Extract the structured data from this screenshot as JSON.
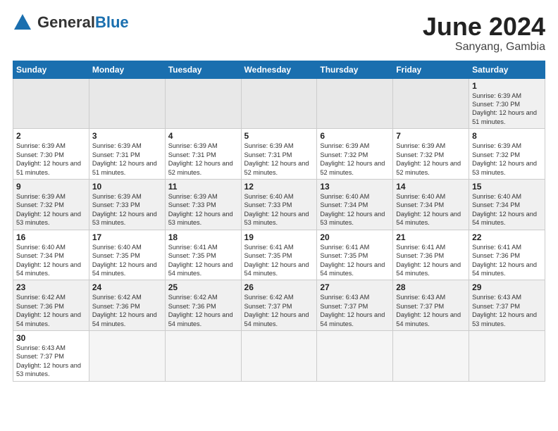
{
  "header": {
    "logo_general": "General",
    "logo_blue": "Blue",
    "title": "June 2024",
    "subtitle": "Sanyang, Gambia"
  },
  "weekdays": [
    "Sunday",
    "Monday",
    "Tuesday",
    "Wednesday",
    "Thursday",
    "Friday",
    "Saturday"
  ],
  "weeks": [
    [
      {
        "day": "",
        "empty": true
      },
      {
        "day": "",
        "empty": true
      },
      {
        "day": "",
        "empty": true
      },
      {
        "day": "",
        "empty": true
      },
      {
        "day": "",
        "empty": true
      },
      {
        "day": "",
        "empty": true
      },
      {
        "day": "1",
        "info": "Sunrise: 6:39 AM\nSunset: 7:30 PM\nDaylight: 12 hours\nand 51 minutes."
      }
    ],
    [
      {
        "day": "2",
        "info": "Sunrise: 6:39 AM\nSunset: 7:30 PM\nDaylight: 12 hours\nand 51 minutes."
      },
      {
        "day": "3",
        "info": "Sunrise: 6:39 AM\nSunset: 7:31 PM\nDaylight: 12 hours\nand 51 minutes."
      },
      {
        "day": "4",
        "info": "Sunrise: 6:39 AM\nSunset: 7:31 PM\nDaylight: 12 hours\nand 52 minutes."
      },
      {
        "day": "5",
        "info": "Sunrise: 6:39 AM\nSunset: 7:31 PM\nDaylight: 12 hours\nand 52 minutes."
      },
      {
        "day": "6",
        "info": "Sunrise: 6:39 AM\nSunset: 7:32 PM\nDaylight: 12 hours\nand 52 minutes."
      },
      {
        "day": "7",
        "info": "Sunrise: 6:39 AM\nSunset: 7:32 PM\nDaylight: 12 hours\nand 52 minutes."
      },
      {
        "day": "8",
        "info": "Sunrise: 6:39 AM\nSunset: 7:32 PM\nDaylight: 12 hours\nand 53 minutes."
      }
    ],
    [
      {
        "day": "9",
        "info": "Sunrise: 6:39 AM\nSunset: 7:32 PM\nDaylight: 12 hours\nand 53 minutes."
      },
      {
        "day": "10",
        "info": "Sunrise: 6:39 AM\nSunset: 7:33 PM\nDaylight: 12 hours\nand 53 minutes."
      },
      {
        "day": "11",
        "info": "Sunrise: 6:39 AM\nSunset: 7:33 PM\nDaylight: 12 hours\nand 53 minutes."
      },
      {
        "day": "12",
        "info": "Sunrise: 6:40 AM\nSunset: 7:33 PM\nDaylight: 12 hours\nand 53 minutes."
      },
      {
        "day": "13",
        "info": "Sunrise: 6:40 AM\nSunset: 7:34 PM\nDaylight: 12 hours\nand 53 minutes."
      },
      {
        "day": "14",
        "info": "Sunrise: 6:40 AM\nSunset: 7:34 PM\nDaylight: 12 hours\nand 54 minutes."
      },
      {
        "day": "15",
        "info": "Sunrise: 6:40 AM\nSunset: 7:34 PM\nDaylight: 12 hours\nand 54 minutes."
      }
    ],
    [
      {
        "day": "16",
        "info": "Sunrise: 6:40 AM\nSunset: 7:34 PM\nDaylight: 12 hours\nand 54 minutes."
      },
      {
        "day": "17",
        "info": "Sunrise: 6:40 AM\nSunset: 7:35 PM\nDaylight: 12 hours\nand 54 minutes."
      },
      {
        "day": "18",
        "info": "Sunrise: 6:41 AM\nSunset: 7:35 PM\nDaylight: 12 hours\nand 54 minutes."
      },
      {
        "day": "19",
        "info": "Sunrise: 6:41 AM\nSunset: 7:35 PM\nDaylight: 12 hours\nand 54 minutes."
      },
      {
        "day": "20",
        "info": "Sunrise: 6:41 AM\nSunset: 7:35 PM\nDaylight: 12 hours\nand 54 minutes."
      },
      {
        "day": "21",
        "info": "Sunrise: 6:41 AM\nSunset: 7:36 PM\nDaylight: 12 hours\nand 54 minutes."
      },
      {
        "day": "22",
        "info": "Sunrise: 6:41 AM\nSunset: 7:36 PM\nDaylight: 12 hours\nand 54 minutes."
      }
    ],
    [
      {
        "day": "23",
        "info": "Sunrise: 6:42 AM\nSunset: 7:36 PM\nDaylight: 12 hours\nand 54 minutes."
      },
      {
        "day": "24",
        "info": "Sunrise: 6:42 AM\nSunset: 7:36 PM\nDaylight: 12 hours\nand 54 minutes."
      },
      {
        "day": "25",
        "info": "Sunrise: 6:42 AM\nSunset: 7:36 PM\nDaylight: 12 hours\nand 54 minutes."
      },
      {
        "day": "26",
        "info": "Sunrise: 6:42 AM\nSunset: 7:37 PM\nDaylight: 12 hours\nand 54 minutes."
      },
      {
        "day": "27",
        "info": "Sunrise: 6:43 AM\nSunset: 7:37 PM\nDaylight: 12 hours\nand 54 minutes."
      },
      {
        "day": "28",
        "info": "Sunrise: 6:43 AM\nSunset: 7:37 PM\nDaylight: 12 hours\nand 54 minutes."
      },
      {
        "day": "29",
        "info": "Sunrise: 6:43 AM\nSunset: 7:37 PM\nDaylight: 12 hours\nand 53 minutes."
      }
    ],
    [
      {
        "day": "30",
        "info": "Sunrise: 6:43 AM\nSunset: 7:37 PM\nDaylight: 12 hours\nand 53 minutes."
      },
      {
        "day": "",
        "empty": true
      },
      {
        "day": "",
        "empty": true
      },
      {
        "day": "",
        "empty": true
      },
      {
        "day": "",
        "empty": true
      },
      {
        "day": "",
        "empty": true
      },
      {
        "day": "",
        "empty": true
      }
    ]
  ]
}
